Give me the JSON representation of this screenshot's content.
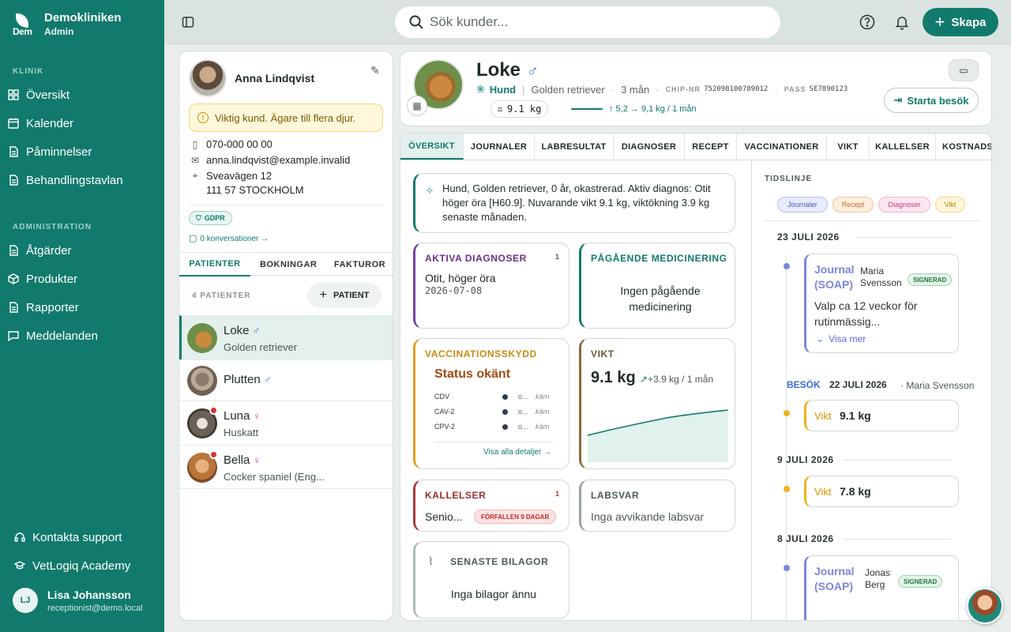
{
  "sidebar": {
    "logo_text": "Dem",
    "clinic_name": "Demokliniken",
    "role": "Admin",
    "section_klinik": "KLINIK",
    "section_admin": "ADMINISTRATION",
    "items": [
      {
        "label": "Översikt",
        "icon": "grid-icon"
      },
      {
        "label": "Kalender",
        "icon": "calendar-icon"
      },
      {
        "label": "Påminnelser",
        "icon": "document-icon"
      },
      {
        "label": "Behandlingstavlan",
        "icon": "document-icon"
      },
      {
        "label": "Åtgärder",
        "icon": "document-icon"
      },
      {
        "label": "Produkter",
        "icon": "box-icon"
      },
      {
        "label": "Rapporter",
        "icon": "document-icon"
      },
      {
        "label": "Meddelanden",
        "icon": "chat-icon"
      }
    ],
    "support": "Kontakta support",
    "academy": "VetLogiq Academy",
    "user": {
      "initials": "LJ",
      "name": "Lisa Johansson",
      "email": "receptionist@demo.local"
    }
  },
  "topbar": {
    "search_placeholder": "Sök kunder...",
    "create_label": "Skapa"
  },
  "owner": {
    "name": "Anna Lindqvist",
    "alert": "Viktig kund. Ägare till flera djur.",
    "phone": "070-000 00 00",
    "email": "anna.lindqvist@example.invalid",
    "street": "Sveavägen 12",
    "city": "111 57 STOCKHOLM",
    "gdpr": "GDPR",
    "conversations": "0 konversationer →",
    "tabs": [
      "PATIENTER",
      "BOKNINGAR",
      "FAKTUROR"
    ],
    "patient_count": "4 PATIENTER",
    "add_patient": "PATIENT",
    "patients": [
      {
        "name": "Loke",
        "sex": "♂",
        "breed": "Golden retriever",
        "dot": ""
      },
      {
        "name": "Plutten",
        "sex": "♂",
        "breed": "",
        "dot": ""
      },
      {
        "name": "Luna",
        "sex": "♀",
        "breed": "Huskatt",
        "dot": "red"
      },
      {
        "name": "Bella",
        "sex": "♀",
        "breed": "Cocker spaniel (Eng...",
        "dot": "red"
      }
    ]
  },
  "pet": {
    "name": "Loke",
    "sex": "♂",
    "species": "Hund",
    "breed": "Golden retriever",
    "age": "3 mån",
    "chip_label": "CHIP-NR",
    "chip_value": "752098100789012",
    "pass_label": "PASS",
    "pass_value": "SE7890123",
    "weight": "9.1 kg",
    "weight_trend": "↑ 5,2 → 9,1 kg / 1 mån",
    "start_visit": "Starta besök"
  },
  "tabs": [
    "ÖVERSIKT",
    "JOURNALER",
    "LABRESULTAT",
    "DIAGNOSER",
    "RECEPT",
    "VACCINATIONER",
    "VIKT",
    "KALLELSER",
    "KOSTNADS"
  ],
  "summary": "Hund, Golden retriever, 0 år, okastrerad. Aktiv diagnos: Otit höger öra [H60.9]. Nuvarande vikt 9.1 kg, viktökning 3.9 kg senaste månaden.",
  "tiles": {
    "diag_title": "AKTIVA DIAGNOSER",
    "diag_count": "1",
    "diag_name": "Otit, höger öra",
    "diag_date": "2026-07-08",
    "med_title": "PÅGÅENDE MEDICINERING",
    "med_text": "Ingen pågående medicinering",
    "vacc_title": "VACCINATIONSSKYDD",
    "vacc_status": "Status okänt",
    "vacc_rows": [
      {
        "name": "CDV",
        "status": "o...",
        "kind": "kärn"
      },
      {
        "name": "CAV-2",
        "status": "o...",
        "kind": "kärn"
      },
      {
        "name": "CPV-2",
        "status": "o...",
        "kind": "kärn"
      }
    ],
    "vacc_link": "Visa alla detaljer →",
    "weight_title": "VIKT",
    "weight_value": "9.1 kg",
    "weight_change": "+3.9 kg / 1 mån",
    "kall_title": "KALLELSER",
    "kall_count": "1",
    "kall_text": "Senio...",
    "kall_badge": "FÖRFALLEN 9 DAGAR",
    "lab_title": "LABSVAR",
    "lab_text": "Inga avvikande labsvar",
    "attach_title": "SENASTE BILAGOR",
    "attach_text": "Inga bilagor ännu"
  },
  "timeline": {
    "title": "TIDSLINJE",
    "filters": [
      "Journaler",
      "Recept",
      "Diagnoser",
      "Vikt"
    ],
    "date1": "23 JULI 2026",
    "j1_type": "Journal (SOAP)",
    "j1_author": "Maria Svensson",
    "j1_badge": "SIGNERAD",
    "j1_text": "Valp ca 12 veckor för rutinmässig...",
    "j1_more": "Visa mer",
    "visit_label": "BESÖK",
    "date2": "22 JULI 2026",
    "visit_author": "· Maria Svensson",
    "w1_label": "Vikt",
    "w1_value": "9.1 kg",
    "date3": "9 JULI 2026",
    "w2_label": "Vikt",
    "w2_value": "7.8 kg",
    "date4": "8 JULI 2026",
    "j2_type": "Journal (SOAP)",
    "j2_author": "Jonas Berg",
    "j2_badge": "SIGNERAD"
  },
  "colors": {
    "brand": "#117a6c",
    "alert_bg": "#fff7dc"
  }
}
